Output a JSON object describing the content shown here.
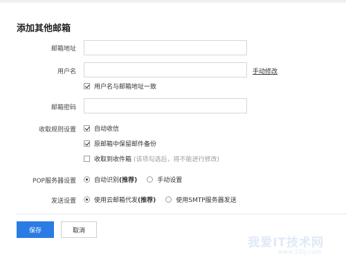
{
  "title": "添加其他邮箱",
  "fields": {
    "email_label": "邮箱地址",
    "username_label": "用户名",
    "manual_edit_link": "手动修改",
    "same_as_email_label": "用户名与邮箱地址一致",
    "password_label": "邮箱密码"
  },
  "rules": {
    "label": "收取规则设置",
    "auto_receive": "自动收信",
    "keep_backup": "原邮箱中保留邮件备份",
    "receive_inbox": "收取到收件箱",
    "receive_inbox_hint": "(该项勾选后，将不能进行修改)"
  },
  "pop": {
    "label": "POP服务器设置",
    "auto_detect": "自动识别",
    "auto_detect_tag": "(推荐)",
    "manual": "手动设置"
  },
  "send": {
    "label": "发送设置",
    "cloud": "使用云邮箱代发",
    "cloud_tag": "(推荐)",
    "smtp": "使用SMTP服务器发送"
  },
  "buttons": {
    "save": "保存",
    "cancel": "取消"
  },
  "watermark": {
    "text": "我爱IT技术网",
    "url": "www.52ij.com"
  },
  "colors": {
    "primary": "#2b7be4"
  }
}
